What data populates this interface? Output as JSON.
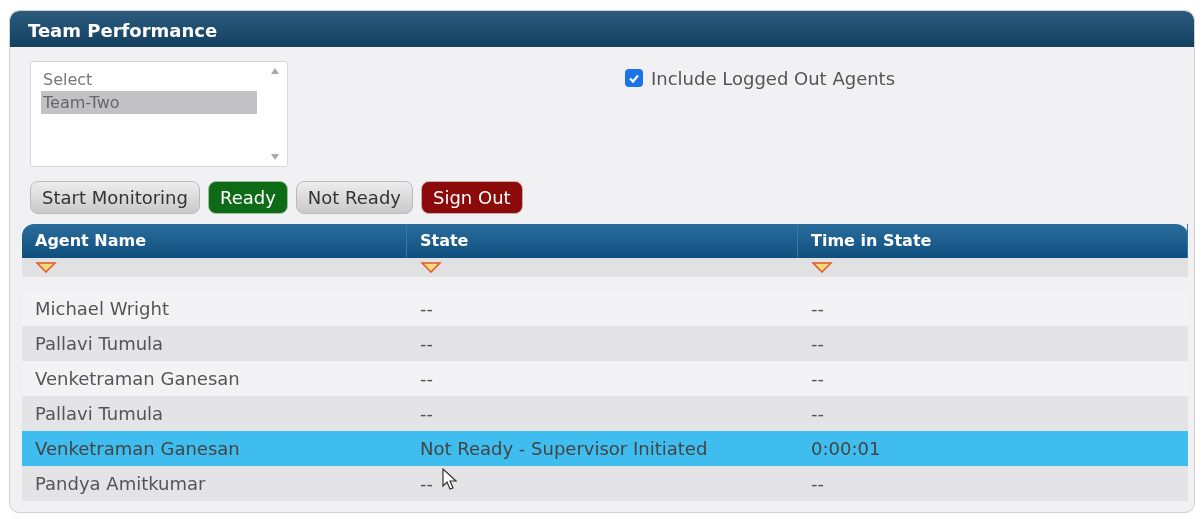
{
  "panel": {
    "title": "Team Performance"
  },
  "team_list": {
    "options": [
      {
        "label": "Select",
        "selected": false
      },
      {
        "label": "Team-Two",
        "selected": true
      }
    ]
  },
  "include_logged_out": {
    "label": "Include Logged Out Agents",
    "checked": true
  },
  "buttons": [
    {
      "label": "Start Monitoring",
      "kind": "neutral"
    },
    {
      "label": "Ready",
      "kind": "ready"
    },
    {
      "label": "Not Ready",
      "kind": "neutral"
    },
    {
      "label": "Sign Out",
      "kind": "danger"
    }
  ],
  "table": {
    "columns": [
      "Agent Name",
      "State",
      "Time in State"
    ],
    "rows": [
      {
        "cells": [
          "Michael Wright",
          "--",
          "--"
        ],
        "selected": false
      },
      {
        "cells": [
          "Pallavi Tumula",
          "--",
          "--"
        ],
        "selected": false
      },
      {
        "cells": [
          "Venketraman Ganesan",
          "--",
          "--"
        ],
        "selected": false
      },
      {
        "cells": [
          "Pallavi Tumula",
          "--",
          "--"
        ],
        "selected": false
      },
      {
        "cells": [
          "Venketraman Ganesan",
          "Not Ready - Supervisor Initiated",
          "0:00:01"
        ],
        "selected": true
      },
      {
        "cells": [
          "Pandya Amitkumar",
          "--",
          "--"
        ],
        "selected": false
      }
    ]
  }
}
